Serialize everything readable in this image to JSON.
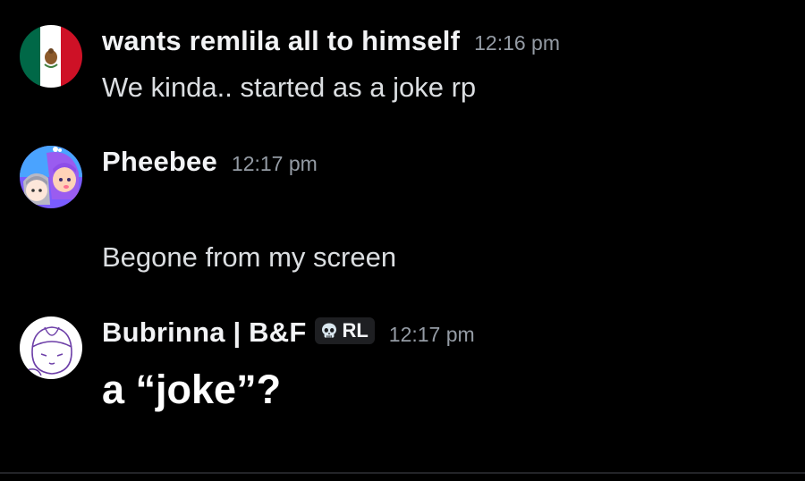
{
  "messages": [
    {
      "username": "wants remlila all to himself",
      "time": "12:16 pm",
      "avatar_icon": "mexico-flag-avatar-icon",
      "text": "We kinda.. started as a joke rp"
    },
    {
      "username": "Pheebee",
      "time": "12:17 pm",
      "avatar_icon": "anime-characters-avatar-icon",
      "text": "Begone from my screen"
    },
    {
      "username": "Bubrinna | B&F",
      "time": "12:17 pm",
      "avatar_icon": "sketch-face-avatar-icon",
      "tag": {
        "icon": "skull-icon",
        "label": "RL"
      },
      "text": "a “joke”?"
    }
  ],
  "colors": {
    "background": "#000000",
    "username": "#f2f3f5",
    "timestamp": "#949ba4",
    "message_text": "#dbdee1",
    "tag_background": "#1e1f22"
  }
}
